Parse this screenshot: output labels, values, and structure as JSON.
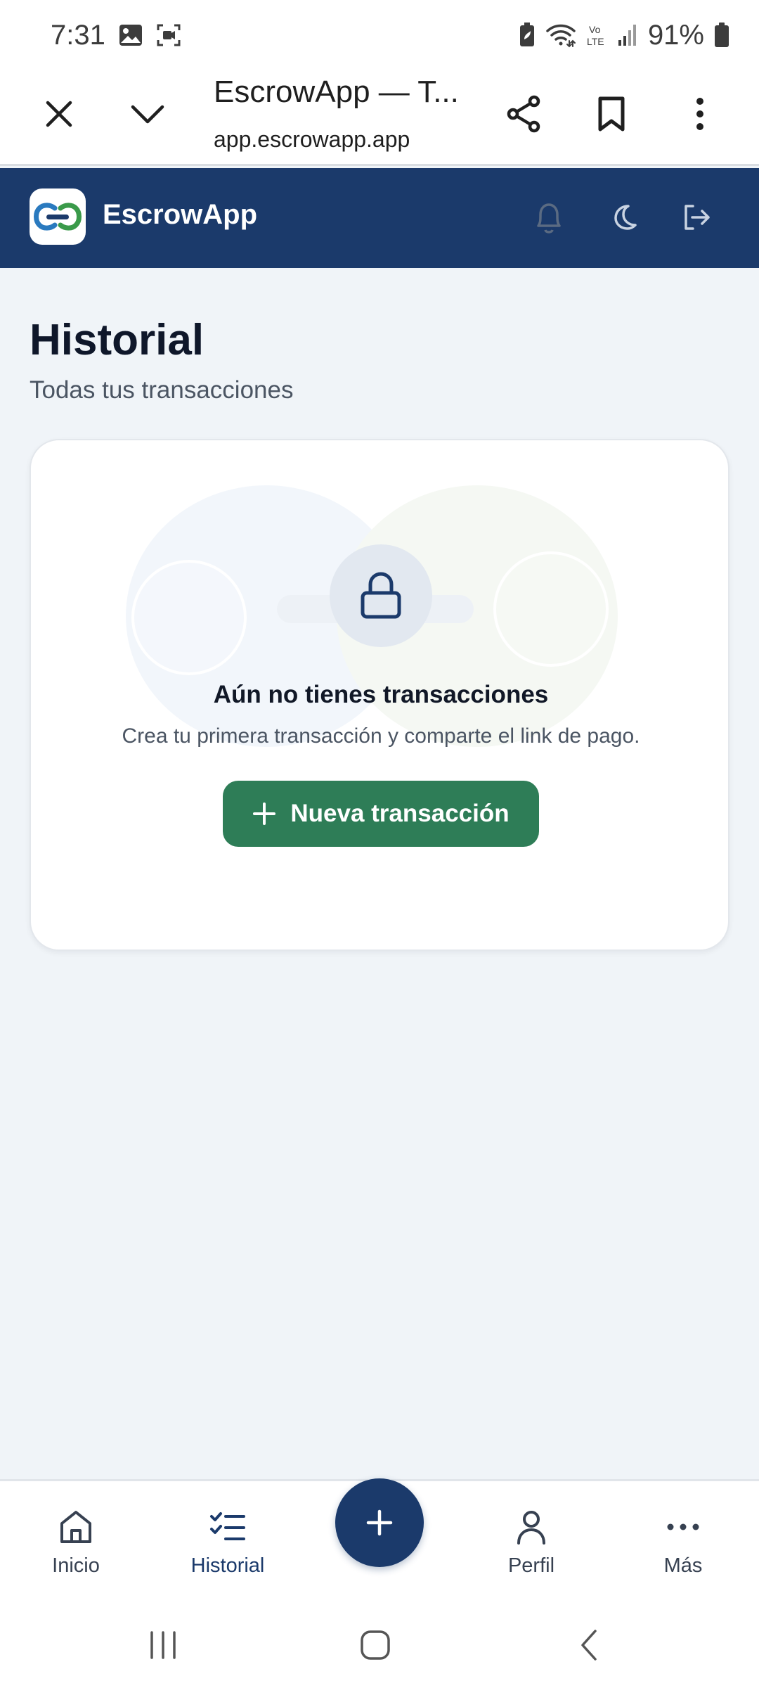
{
  "status_bar": {
    "time": "7:31",
    "battery": "91%",
    "icons": [
      "gallery-icon",
      "screen-record-icon",
      "battery-saver-icon",
      "wifi-icon",
      "volte-icon",
      "signal-icon",
      "battery-icon"
    ],
    "volte_label_top": "Vo",
    "volte_label_bottom": "LTE"
  },
  "browser": {
    "title": "EscrowApp — T...",
    "url": "app.escrowapp.app",
    "icons": [
      "close-icon",
      "chevron-down-icon",
      "share-icon",
      "bookmark-icon",
      "more-vert-icon"
    ]
  },
  "header": {
    "app_name": "EscrowApp",
    "icons": [
      "bell-icon",
      "moon-icon",
      "logout-icon"
    ],
    "brand_color": "#1b3a6b"
  },
  "page": {
    "title": "Historial",
    "subtitle": "Todas tus transacciones"
  },
  "empty_state": {
    "icon": "lock-icon",
    "title": "Aún no tienes transacciones",
    "description": "Crea tu primera transacción y comparte el link de pago.",
    "button_label": "Nueva transacción",
    "button_color": "#2e7d57"
  },
  "bottom_nav": {
    "items": [
      {
        "label": "Inicio",
        "icon": "home-icon",
        "active": false
      },
      {
        "label": "Historial",
        "icon": "checklist-icon",
        "active": true
      },
      {
        "label": "Perfil",
        "icon": "user-icon",
        "active": false
      },
      {
        "label": "Más",
        "icon": "more-horiz-icon",
        "active": false
      }
    ],
    "fab_icon": "plus-icon"
  },
  "system_nav": {
    "icons": [
      "recents-icon",
      "home-button-icon",
      "back-icon"
    ]
  }
}
